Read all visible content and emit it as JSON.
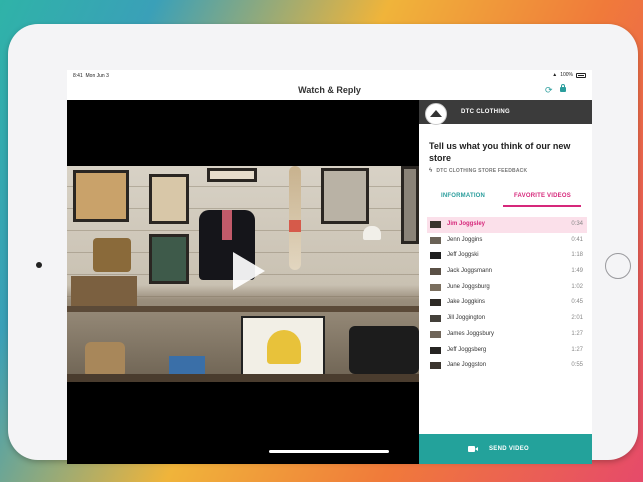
{
  "status_bar": {
    "time": "8:41",
    "date": "Mon Jun 3",
    "battery": "100%"
  },
  "header": {
    "title": "Watch & Reply"
  },
  "icons": {
    "refresh": "refresh-icon",
    "lock": "lock-icon",
    "play": "play-icon",
    "camera": "video-camera-icon",
    "brand_logo": "hanger-logo-icon"
  },
  "colors": {
    "accent_teal": "#23a29b",
    "accent_pink": "#d6287b",
    "brand_bar": "#3b3b3b"
  },
  "panel": {
    "brand_name": "DTC CLOTHING",
    "headline": "Tell us what you think of our new store",
    "subtitle": "DTC CLOTHING STORE FEEDBACK",
    "tabs": [
      {
        "label": "INFORMATION",
        "active": false
      },
      {
        "label": "FAVORITE VIDEOS",
        "active": true
      }
    ],
    "videos": [
      {
        "name": "Jim Joggsley",
        "duration": "0:34",
        "selected": true
      },
      {
        "name": "Jenn Joggins",
        "duration": "0:41"
      },
      {
        "name": "Jeff Joggski",
        "duration": "1:18"
      },
      {
        "name": "Jack Joggsmann",
        "duration": "1:49"
      },
      {
        "name": "June Joggsburg",
        "duration": "1:02"
      },
      {
        "name": "Jake Joggkins",
        "duration": "0:45"
      },
      {
        "name": "Jill Joggington",
        "duration": "2:01"
      },
      {
        "name": "James Joggsbury",
        "duration": "1:27"
      },
      {
        "name": "Jeff Joggsberg",
        "duration": "1:27"
      },
      {
        "name": "Jane Joggston",
        "duration": "0:55"
      }
    ],
    "send_label": "SEND VIDEO"
  }
}
